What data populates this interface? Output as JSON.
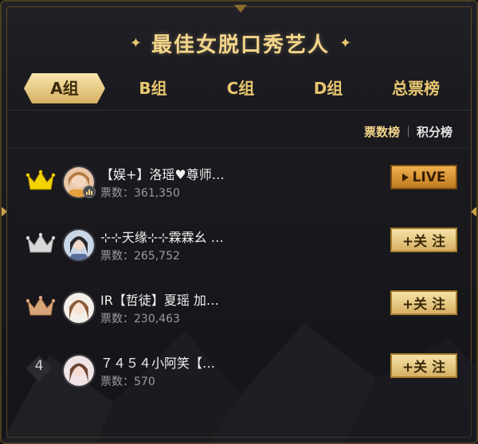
{
  "header": {
    "title": "最佳女脱口秀艺人",
    "star_glyph": "✦"
  },
  "tabs": [
    {
      "label": "A组",
      "active": true
    },
    {
      "label": "B组",
      "active": false
    },
    {
      "label": "C组",
      "active": false
    },
    {
      "label": "D组",
      "active": false
    },
    {
      "label": "总票榜",
      "active": false
    }
  ],
  "sort": {
    "options": [
      "票数榜",
      "积分榜"
    ],
    "active_index": 0
  },
  "list": [
    {
      "rank": 1,
      "rank_display": "crown-gold-icon",
      "name": "【娱+】洛瑶♥尊师…",
      "votes": "票数：361,350",
      "action": "LIVE",
      "live": true
    },
    {
      "rank": 2,
      "rank_display": "crown-silver-icon",
      "name": "⊹⊹天缘⊹⊹霖霖幺 …",
      "votes": "票数：265,752",
      "action": "+关 注",
      "live": false
    },
    {
      "rank": 3,
      "rank_display": "crown-bronze-icon",
      "name": "IR【哲徒】夏瑶 加…",
      "votes": "票数：230,463",
      "action": "+关 注",
      "live": false
    },
    {
      "rank": 4,
      "rank_display": "4",
      "name": "７４５４小阿笑【…",
      "votes": "票数：570",
      "action": "+关 注",
      "live": false
    }
  ],
  "colors": {
    "gold": "#f3d58a",
    "accent_bg": "#d7b161",
    "live": "#c07a1e",
    "panel": "#18181c"
  }
}
